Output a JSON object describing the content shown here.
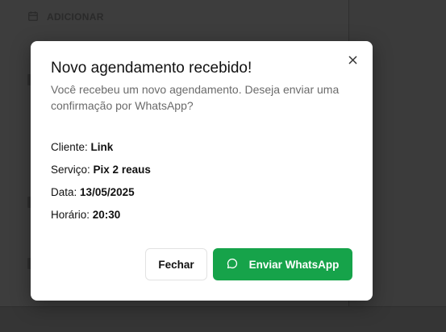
{
  "background": {
    "add_label": "ADICIONAR",
    "add_icon": "calendar-icon"
  },
  "dialog": {
    "title": "Novo agendamento recebido!",
    "subtitle": "Você recebeu um novo agendamento. Deseja enviar uma confirmação por WhatsApp?",
    "close_icon": "close-icon",
    "details": [
      {
        "label": "Cliente:",
        "value": "Link"
      },
      {
        "label": "Serviço:",
        "value": "Pix 2 reaus"
      },
      {
        "label": "Data:",
        "value": "13/05/2025"
      },
      {
        "label": "Horário:",
        "value": "20:30"
      }
    ],
    "buttons": {
      "close_label": "Fechar",
      "whatsapp_label": "Enviar WhatsApp",
      "whatsapp_icon": "message-circle-icon"
    }
  },
  "colors": {
    "primary_button": "#16a34a",
    "overlay": "#3b3b3b"
  }
}
